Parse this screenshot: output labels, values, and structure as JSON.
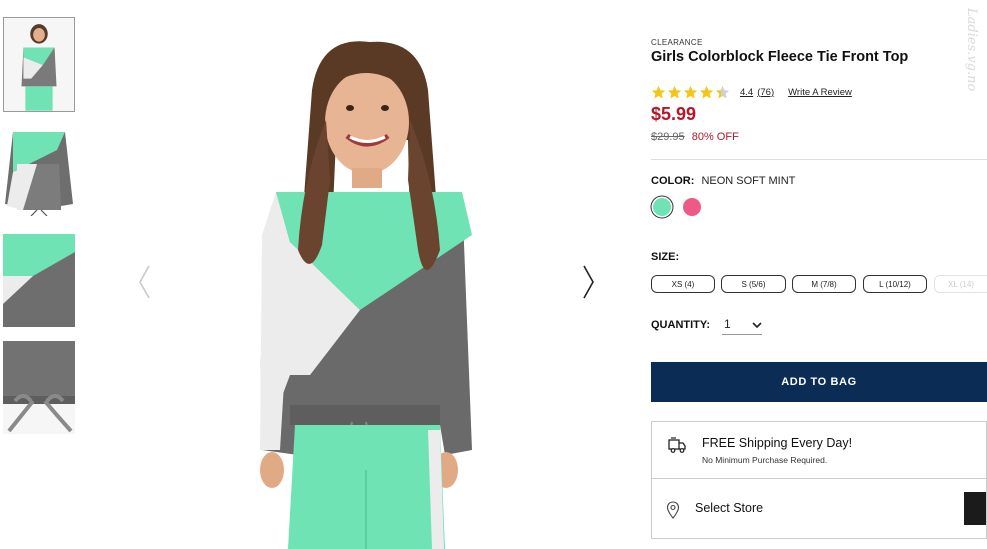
{
  "thumbnails": [
    {
      "name": "model-front-view"
    },
    {
      "name": "flat-product-view"
    },
    {
      "name": "fabric-detail-view"
    },
    {
      "name": "drawstring-detail-view"
    }
  ],
  "product": {
    "badge": "CLEARANCE",
    "title": "Girls Colorblock Fleece Tie Front Top",
    "rating_value": "4.4",
    "rating_count": "(76)",
    "rating_stars": 4.4,
    "write_review": "Write A Review",
    "price": "$5.99",
    "original_price": "$29.95",
    "discount": "80% OFF"
  },
  "color": {
    "label": "COLOR:",
    "selected": "NEON SOFT MINT",
    "swatches": [
      {
        "name": "neon-soft-mint",
        "hex": "#6fe3b3",
        "selected": true
      },
      {
        "name": "pink",
        "hex": "#ee5a86",
        "selected": false
      }
    ]
  },
  "size": {
    "label": "SIZE:",
    "options": [
      {
        "label": "XS (4)",
        "available": true
      },
      {
        "label": "S (5/6)",
        "available": true
      },
      {
        "label": "M (7/8)",
        "available": true
      },
      {
        "label": "L (10/12)",
        "available": true
      },
      {
        "label": "XL (14)",
        "available": false
      }
    ]
  },
  "quantity": {
    "label": "QUANTITY:",
    "value": "1"
  },
  "add_to_bag": "ADD TO BAG",
  "shipping": {
    "title": "FREE Shipping Every Day!",
    "subtitle": "No Minimum Purchase Required."
  },
  "store": {
    "label": "Select Store"
  },
  "watermark": "Ladies.vg.no",
  "colors": {
    "accent": "#0b2c55",
    "sale": "#b5172a",
    "star": "#f5c518",
    "mint": "#6fe3b3",
    "heather": "#6e6e6e"
  }
}
